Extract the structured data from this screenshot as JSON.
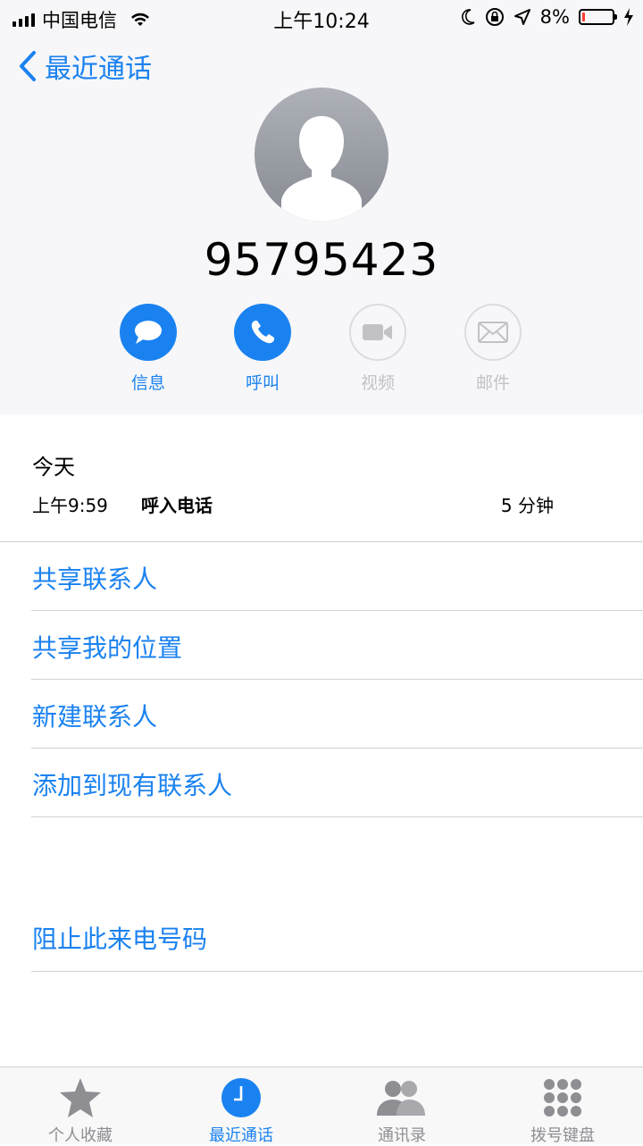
{
  "status_bar": {
    "carrier": "中国电信",
    "time": "上午10:24",
    "battery": "8%",
    "battery_level": 0.08
  },
  "nav": {
    "back_label": "最近通话"
  },
  "contact": {
    "number": "95795423"
  },
  "actions": [
    {
      "label": "信息",
      "icon": "message-icon",
      "enabled": true
    },
    {
      "label": "呼叫",
      "icon": "phone-icon",
      "enabled": true
    },
    {
      "label": "视频",
      "icon": "video-icon",
      "enabled": false
    },
    {
      "label": "邮件",
      "icon": "mail-icon",
      "enabled": false
    }
  ],
  "recent": {
    "day": "今天",
    "time": "上午9:59",
    "type": "呼入电话",
    "duration": "5 分钟"
  },
  "options": {
    "share_contact": "共享联系人",
    "share_location": "共享我的位置",
    "new_contact": "新建联系人",
    "add_existing": "添加到现有联系人",
    "block": "阻止此来电号码"
  },
  "tabs": [
    {
      "label": "个人收藏",
      "icon": "star-icon",
      "active": false
    },
    {
      "label": "最近通话",
      "icon": "clock-icon",
      "active": true
    },
    {
      "label": "通讯录",
      "icon": "contacts-icon",
      "active": false
    },
    {
      "label": "拨号键盘",
      "icon": "keypad-icon",
      "active": false
    }
  ],
  "colors": {
    "accent": "#1a82f0",
    "disabled": "#c2c2c6",
    "header_bg": "#f7f7f9"
  }
}
